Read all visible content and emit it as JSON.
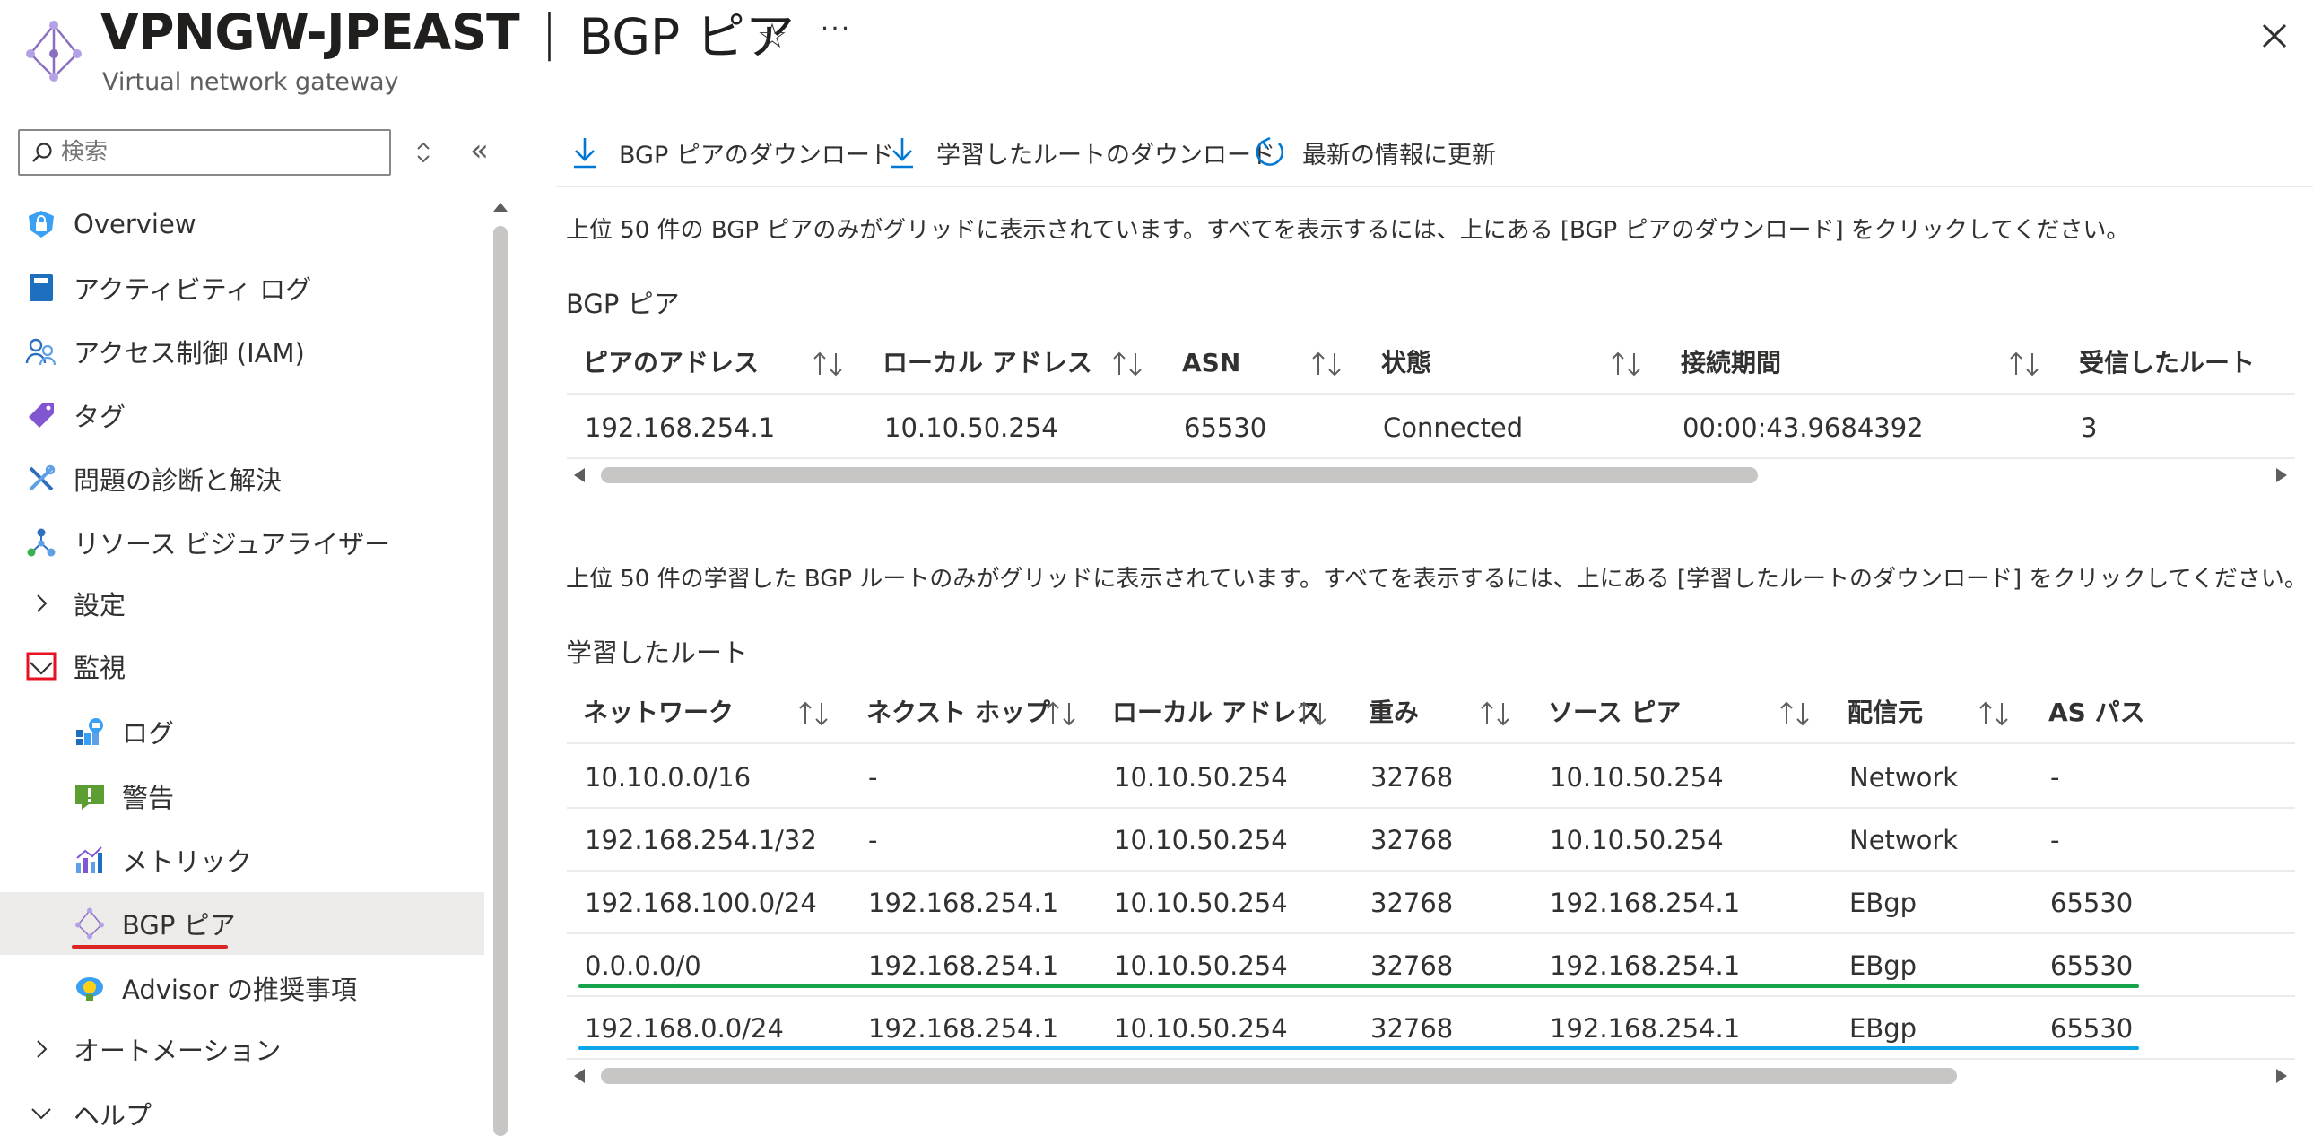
{
  "header": {
    "title": "VPNGW-JPEAST",
    "separator": "|",
    "page": "BGP ピア",
    "subtitle": "Virtual network gateway",
    "star": "☆",
    "more": "···"
  },
  "sidebar": {
    "search_placeholder": "検索",
    "collapse": "«",
    "items": [
      {
        "label": "Overview",
        "icon": "overview-icon"
      },
      {
        "label": "アクティビティ ログ",
        "icon": "activity-log-icon"
      },
      {
        "label": "アクセス制御 (IAM)",
        "icon": "iam-icon"
      },
      {
        "label": "タグ",
        "icon": "tag-icon"
      },
      {
        "label": "問題の診断と解決",
        "icon": "wrench-icon"
      },
      {
        "label": "リソース ビジュアライザー",
        "icon": "resource-visualizer-icon"
      },
      {
        "label": "設定",
        "icon": "chevron-right-icon"
      },
      {
        "label": "監視",
        "icon": "monitoring-icon"
      },
      {
        "label": "ログ",
        "icon": "logs-icon"
      },
      {
        "label": "警告",
        "icon": "alerts-icon"
      },
      {
        "label": "メトリック",
        "icon": "metrics-icon"
      },
      {
        "label": "BGP ピア",
        "icon": "bgp-peers-icon"
      },
      {
        "label": "Advisor の推奨事項",
        "icon": "advisor-icon"
      },
      {
        "label": "オートメーション",
        "icon": "chevron-right-icon"
      },
      {
        "label": "ヘルプ",
        "icon": "chevron-down-icon"
      }
    ]
  },
  "toolbar": {
    "download_peers": "BGP ピアのダウンロード",
    "download_routes": "学習したルートのダウンロード",
    "refresh": "最新の情報に更新"
  },
  "peers": {
    "info": "上位 50 件の BGP ピアのみがグリッドに表示されています。すべてを表示するには、上にある [BGP ピアのダウンロード] をクリックしてください。",
    "title": "BGP ピア",
    "columns": [
      "ピアのアドレス",
      "ローカル アドレス",
      "ASN",
      "状態",
      "接続期間",
      "受信したルート"
    ],
    "rows": [
      [
        "192.168.254.1",
        "10.10.50.254",
        "65530",
        "Connected",
        "00:00:43.9684392",
        "3"
      ]
    ]
  },
  "routes": {
    "info": "上位 50 件の学習した BGP ルートのみがグリッドに表示されています。すべてを表示するには、上にある [学習したルートのダウンロード] をクリックしてください。",
    "title": "学習したルート",
    "columns": [
      "ネットワーク",
      "ネクスト ホップ",
      "ローカル アドレス",
      "重み",
      "ソース ピア",
      "配信元",
      "AS パス"
    ],
    "rows": [
      [
        "10.10.0.0/16",
        "-",
        "10.10.50.254",
        "32768",
        "10.10.50.254",
        "Network",
        "-"
      ],
      [
        "192.168.254.1/32",
        "-",
        "10.10.50.254",
        "32768",
        "10.10.50.254",
        "Network",
        "-"
      ],
      [
        "192.168.100.0/24",
        "192.168.254.1",
        "10.10.50.254",
        "32768",
        "192.168.254.1",
        "EBgp",
        "65530"
      ],
      [
        "0.0.0.0/0",
        "192.168.254.1",
        "10.10.50.254",
        "32768",
        "192.168.254.1",
        "EBgp",
        "65530"
      ],
      [
        "192.168.0.0/24",
        "192.168.254.1",
        "10.10.50.254",
        "32768",
        "192.168.254.1",
        "EBgp",
        "65530"
      ]
    ]
  },
  "colors": {
    "accent": "#0078d4",
    "highlight_green": "#16a34a",
    "highlight_blue": "#0ea5e9",
    "highlight_red": "#dc2626"
  }
}
